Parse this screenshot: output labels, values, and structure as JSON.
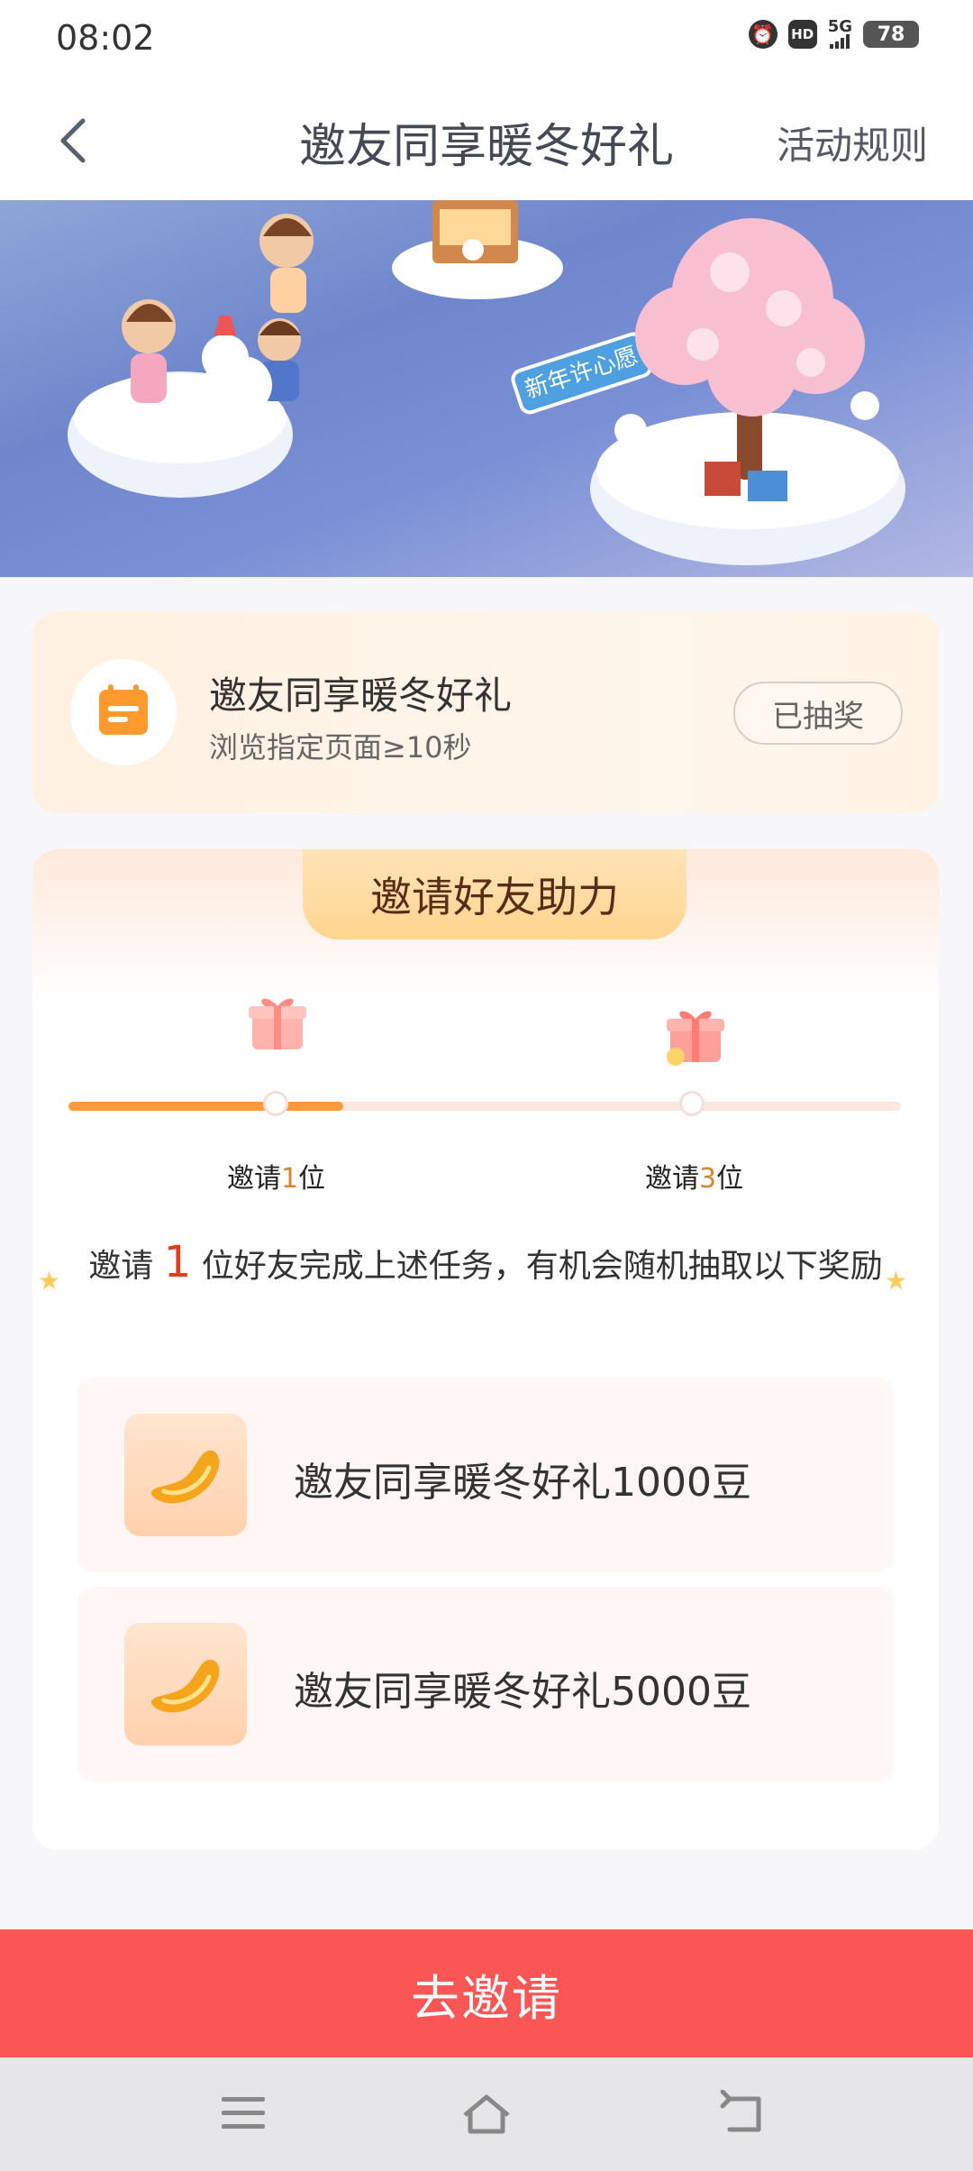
{
  "status_bar": {
    "time": "08:02",
    "network": "5G",
    "hd_badge": "HD",
    "battery": "78"
  },
  "nav": {
    "title": "邀友同享暖冬好礼",
    "rules_label": "活动规则"
  },
  "banner": {
    "sign_text": "新年许心愿"
  },
  "task": {
    "title": "邀友同享暖冬好礼",
    "subtitle": "浏览指定页面≥10秒",
    "button_label": "已抽奖"
  },
  "help": {
    "header": "邀请好友助力",
    "progress": 0.33,
    "milestones": [
      {
        "prefix": "邀请",
        "num": "1",
        "suffix": "位"
      },
      {
        "prefix": "邀请",
        "num": "3",
        "suffix": "位"
      }
    ],
    "reward_desc_prefix": "邀请",
    "reward_desc_count": "1",
    "reward_desc_suffix": "位好友完成上述任务，有机会随机抽取以下奖励",
    "rewards": [
      {
        "label": "邀友同享暖冬好礼1000豆"
      },
      {
        "label": "邀友同享暖冬好礼5000豆"
      }
    ]
  },
  "invite_button": "去邀请",
  "colors": {
    "accent": "#f95655",
    "progress": "#ff9a3c",
    "highlight": "#e33b1e",
    "milestone_num": "#d7882f"
  }
}
